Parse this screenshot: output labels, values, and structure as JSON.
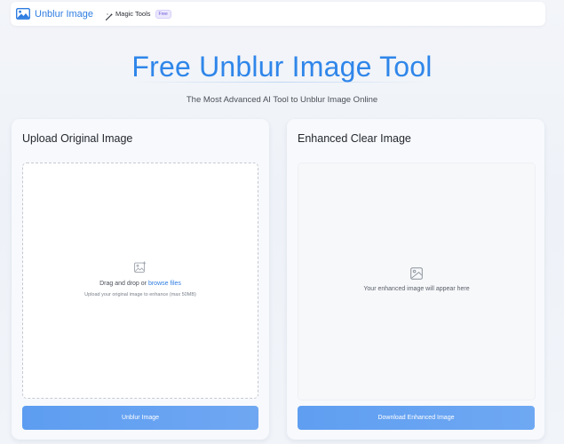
{
  "nav": {
    "brand_icon": "landscape-image-icon",
    "brand_name": "Unblur Image",
    "magic_icon": "magic-wand-icon",
    "magic_label": "Magic Tools",
    "magic_badge": "Free"
  },
  "hero": {
    "title": "Free Unblur Image Tool",
    "subtitle": "The Most Advanced AI Tool to Unblur Image Online"
  },
  "upload_panel": {
    "title": "Upload Original Image",
    "icon": "image-plus-icon",
    "drop_text": "Drag and drop or ",
    "browse_link": "browse files",
    "hint": "Upload your original image to enhance (max 50MB)",
    "button_label": "Unblur Image"
  },
  "result_panel": {
    "title": "Enhanced Clear Image",
    "icon": "image-icon",
    "placeholder": "Your enhanced image will appear here",
    "button_label": "Download Enhanced Image"
  },
  "colors": {
    "accent": "#2f86ea",
    "button": "#6aa4f2",
    "badge": "#6a56d8"
  }
}
